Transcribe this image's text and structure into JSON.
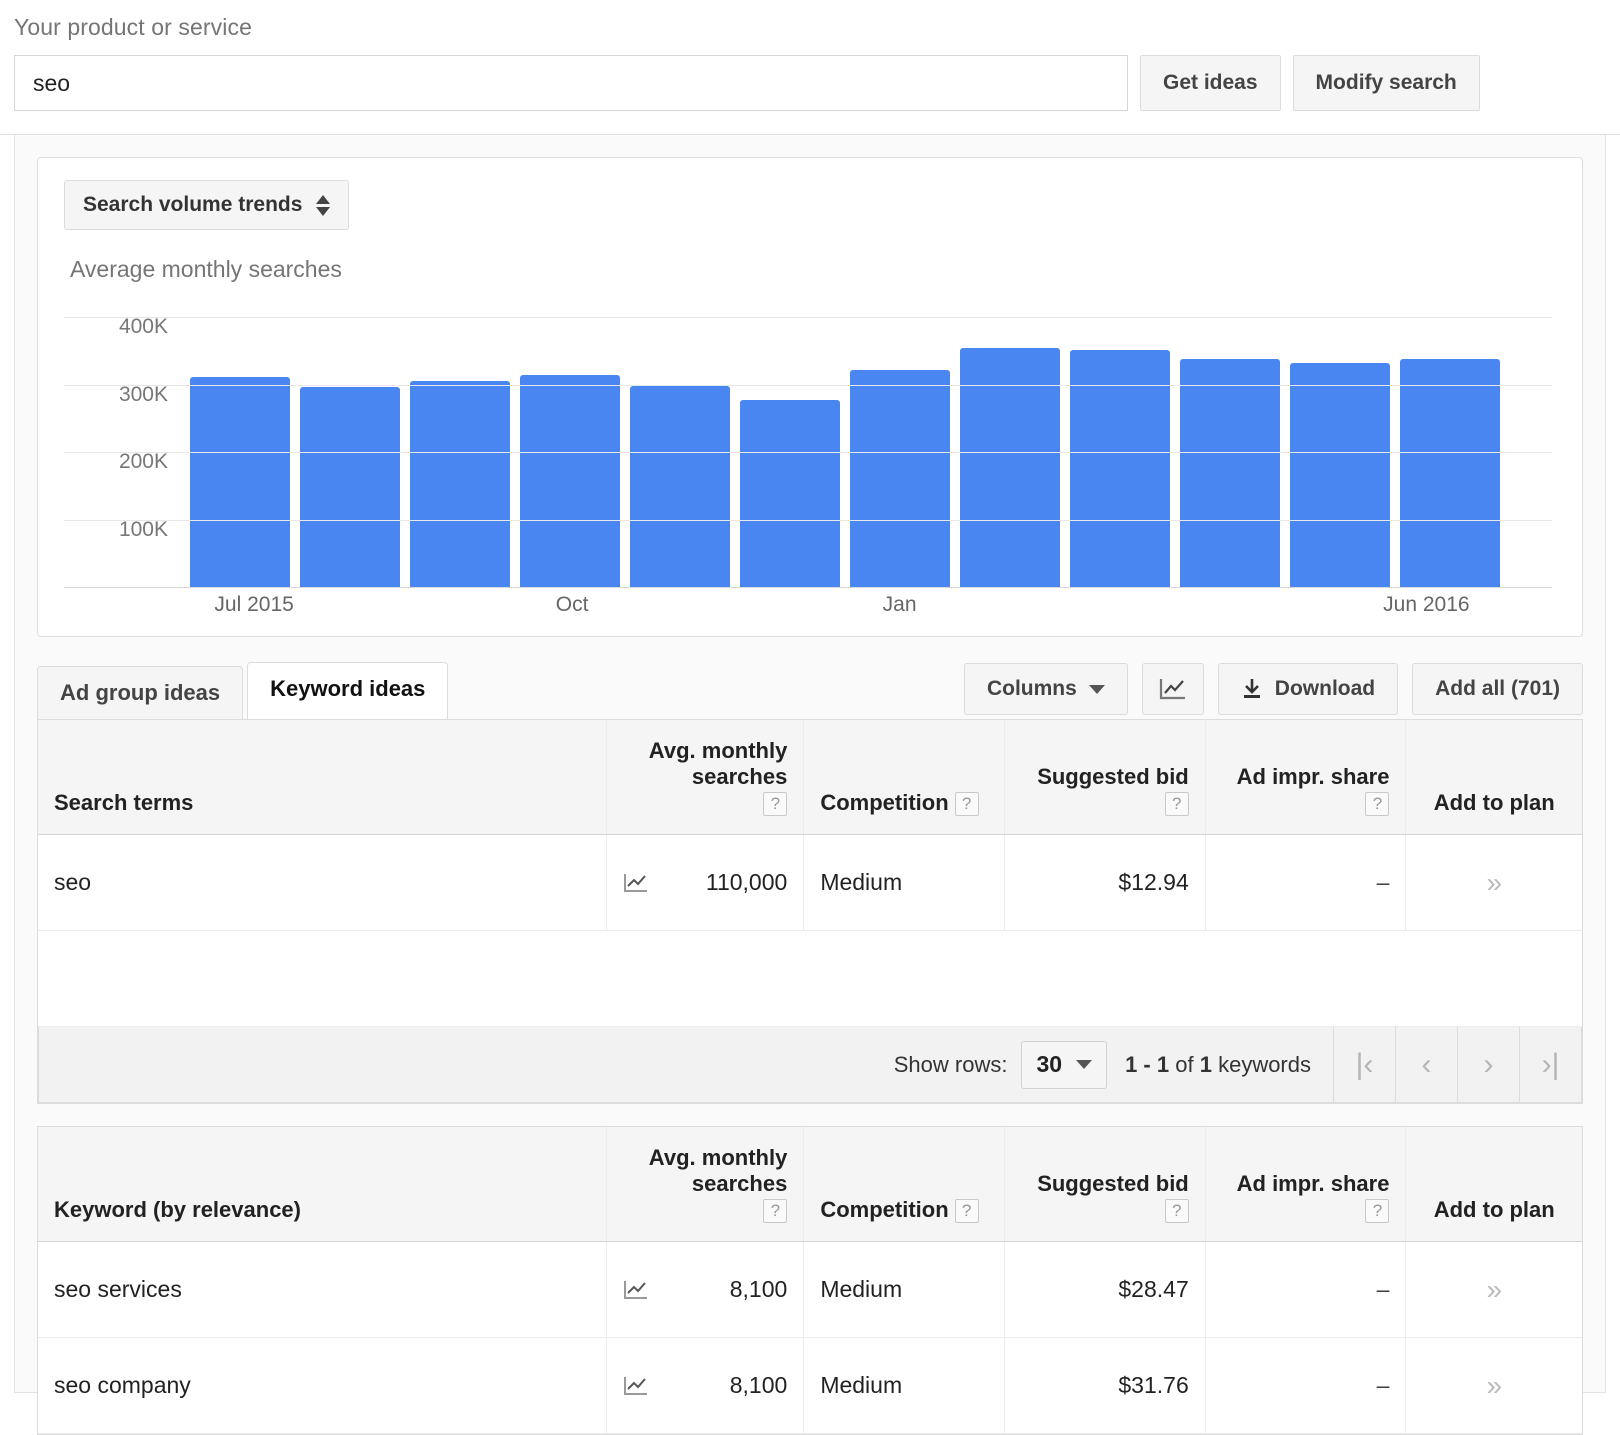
{
  "search": {
    "label": "Your product or service",
    "value": "seo",
    "get_ideas_label": "Get ideas",
    "modify_search_label": "Modify search"
  },
  "chart_panel": {
    "view_select_label": "Search volume trends",
    "chart_title": "Average monthly searches"
  },
  "chart_data": {
    "type": "bar",
    "title": "Average monthly searches",
    "xlabel": "",
    "ylabel": "",
    "ylim": [
      0,
      430000
    ],
    "grid": true,
    "legend": false,
    "bar_color": "#4a86f2",
    "ytick_labels": [
      "400K",
      "300K",
      "200K",
      "100K"
    ],
    "ytick_values": [
      400000,
      300000,
      200000,
      100000
    ],
    "xtick_labels": [
      "Jul 2015",
      "Oct",
      "Jan",
      "Jun 2016"
    ],
    "xtick_indices": [
      0,
      3,
      6,
      11
    ],
    "categories": [
      "Jul 2015",
      "Aug 2015",
      "Sep 2015",
      "Oct 2015",
      "Nov 2015",
      "Dec 2015",
      "Jan 2016",
      "Feb 2016",
      "Mar 2016",
      "Apr 2016",
      "May 2016",
      "Jun 2016"
    ],
    "values": [
      312000,
      296000,
      306000,
      314000,
      298000,
      278000,
      322000,
      355000,
      351000,
      338000,
      332000,
      338000
    ]
  },
  "tabs": [
    {
      "label": "Ad group ideas",
      "active": false
    },
    {
      "label": "Keyword ideas",
      "active": true
    }
  ],
  "toolbar": {
    "columns_label": "Columns",
    "graph_icon": "line-chart-icon",
    "download_label": "Download",
    "download_icon": "download-icon",
    "add_all_label": "Add all (701)"
  },
  "search_terms_table": {
    "headers": {
      "term": "Search terms",
      "volume_line1": "Avg. monthly",
      "volume_line2": "searches",
      "competition": "Competition",
      "bid": "Suggested bid",
      "impr": "Ad impr. share",
      "add": "Add to plan",
      "help_glyph": "?"
    },
    "rows": [
      {
        "term": "seo",
        "volume": "110,000",
        "competition": "Medium",
        "bid": "$12.94",
        "impr": "–",
        "add": "»"
      }
    ]
  },
  "pagination": {
    "show_rows_label": "Show rows:",
    "rows_value": "30",
    "range_prefix": "1 - 1",
    "range_mid": "of",
    "range_count": "1",
    "range_suffix": "keywords",
    "first_glyph": "|‹",
    "prev_glyph": "‹",
    "next_glyph": "›",
    "last_glyph": "›|"
  },
  "keyword_ideas_table": {
    "headers": {
      "term": "Keyword (by relevance)",
      "volume_line1": "Avg. monthly",
      "volume_line2": "searches",
      "competition": "Competition",
      "bid": "Suggested bid",
      "impr": "Ad impr. share",
      "add": "Add to plan",
      "help_glyph": "?"
    },
    "rows": [
      {
        "term": "seo services",
        "volume": "8,100",
        "competition": "Medium",
        "bid": "$28.47",
        "impr": "–",
        "add": "»"
      },
      {
        "term": "seo company",
        "volume": "8,100",
        "competition": "Medium",
        "bid": "$31.76",
        "impr": "–",
        "add": "»"
      }
    ]
  }
}
